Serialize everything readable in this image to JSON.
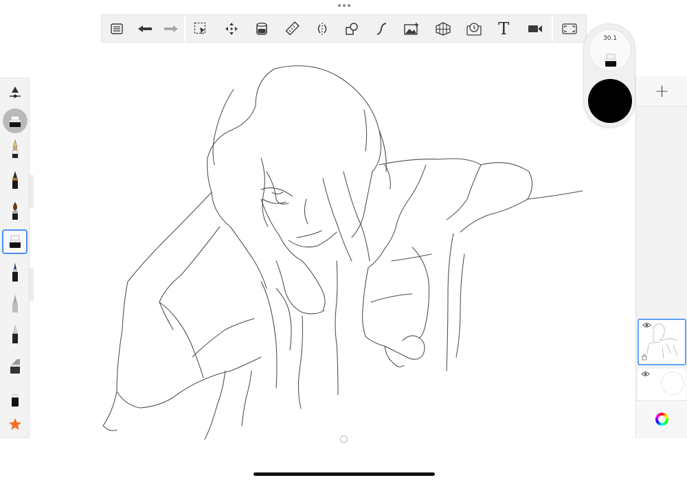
{
  "toolbar": {
    "tools": [
      {
        "id": "menu",
        "icon": "list-icon",
        "enabled": true
      },
      {
        "id": "undo",
        "icon": "undo-arrow-icon",
        "enabled": true
      },
      {
        "id": "redo",
        "icon": "redo-arrow-icon",
        "enabled": false
      },
      {
        "id": "selection",
        "icon": "selection-icon",
        "enabled": true
      },
      {
        "id": "transform",
        "icon": "move-arrows-icon",
        "enabled": true
      },
      {
        "id": "fill",
        "icon": "fill-bucket-icon",
        "enabled": true
      },
      {
        "id": "ruler",
        "icon": "ruler-icon",
        "enabled": true
      },
      {
        "id": "symmetry",
        "icon": "symmetry-icon",
        "enabled": true
      },
      {
        "id": "shapes",
        "icon": "shapes-icon",
        "enabled": true
      },
      {
        "id": "stroke",
        "icon": "curve-stroke-icon",
        "enabled": true
      },
      {
        "id": "image",
        "icon": "add-image-icon",
        "enabled": true
      },
      {
        "id": "perspective",
        "icon": "perspective-grid-icon",
        "enabled": true
      },
      {
        "id": "timelapse",
        "icon": "timelapse-icon",
        "enabled": true
      },
      {
        "id": "text",
        "icon": "text-icon",
        "enabled": true
      },
      {
        "id": "record",
        "icon": "video-camera-icon",
        "enabled": true
      },
      {
        "id": "fullscreen",
        "icon": "fullscreen-icon",
        "enabled": true
      }
    ],
    "text_glyph": "T"
  },
  "brush_panel": {
    "items": [
      {
        "name": "brush-properties",
        "icon": "brush-settings-icon",
        "state": "normal"
      },
      {
        "name": "recent-brush",
        "icon": "marker-brush-icon",
        "state": "round-active"
      },
      {
        "name": "pencil",
        "icon": "pencil-icon",
        "state": "normal"
      },
      {
        "name": "ink-pen",
        "icon": "ink-pen-icon",
        "state": "normal"
      },
      {
        "name": "paint-brush",
        "icon": "paint-brush-icon",
        "state": "normal"
      },
      {
        "name": "marker",
        "icon": "marker-brush-icon",
        "state": "selected"
      },
      {
        "name": "ballpoint-pen",
        "icon": "ballpoint-pen-icon",
        "state": "normal"
      },
      {
        "name": "airbrush",
        "icon": "airbrush-icon",
        "state": "normal"
      },
      {
        "name": "soft-pencil",
        "icon": "soft-pencil-icon",
        "state": "normal"
      },
      {
        "name": "chisel-marker",
        "icon": "chisel-marker-icon",
        "state": "normal"
      },
      {
        "name": "eraser",
        "icon": "eraser-icon",
        "state": "normal"
      },
      {
        "name": "favorites",
        "icon": "star-icon",
        "state": "normal"
      }
    ]
  },
  "puck": {
    "brush_size": "30.1",
    "color": "#000000"
  },
  "layers": {
    "add_label": "+",
    "items": [
      {
        "name": "sketch-layer",
        "visible": true,
        "active": true
      },
      {
        "name": "background-layer",
        "visible": true,
        "active": false
      }
    ]
  },
  "colors": {
    "accent": "#4a8ef0",
    "panel": "#f3f3f3",
    "star": "#f07020"
  }
}
